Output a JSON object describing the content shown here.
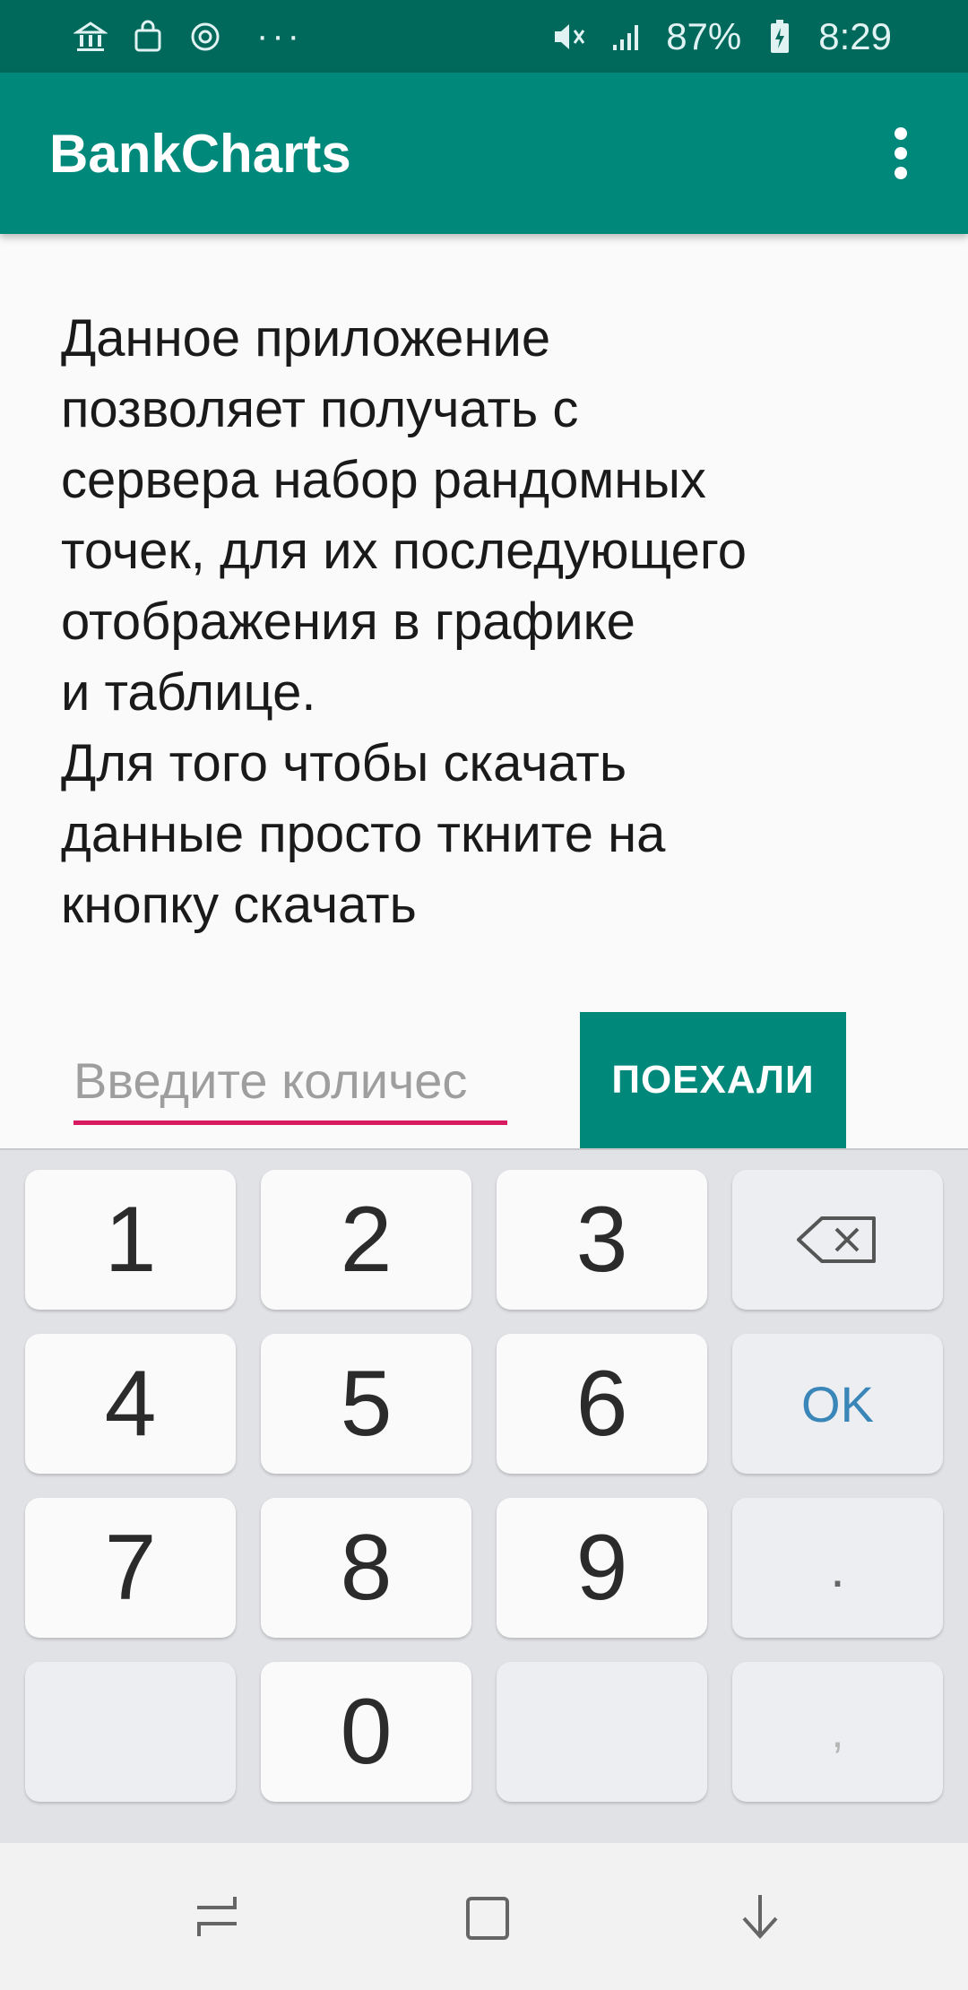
{
  "status_bar": {
    "left_icons": [
      "bank-icon",
      "shopping-bag-icon",
      "sync-icon"
    ],
    "more_indicator": "···",
    "battery_percent": "87%",
    "time": "8:29"
  },
  "app_bar": {
    "title": "BankCharts"
  },
  "main": {
    "description": "Данное приложение\nпозволяет получать с\nсервера набор рандомных\nточек, для их последующего\nотображения в графике\nи таблице.\nДля того чтобы скачать\nданные просто ткните на\nкнопку скачать",
    "count_input": {
      "value": "",
      "placeholder": "Введите количес"
    },
    "go_button_label": "ПОЕХАЛИ"
  },
  "keyboard": {
    "row1": [
      "1",
      "2",
      "3"
    ],
    "row2": [
      "4",
      "5",
      "6"
    ],
    "row3": [
      "7",
      "8",
      "9"
    ],
    "zero": "0",
    "ok_label": "OK",
    "dot_label": ".",
    "comma_label": ","
  },
  "colors": {
    "status_bar": "#00695c",
    "app_bar": "#00897b",
    "accent_underline": "#d81b60",
    "button": "#00897b"
  }
}
